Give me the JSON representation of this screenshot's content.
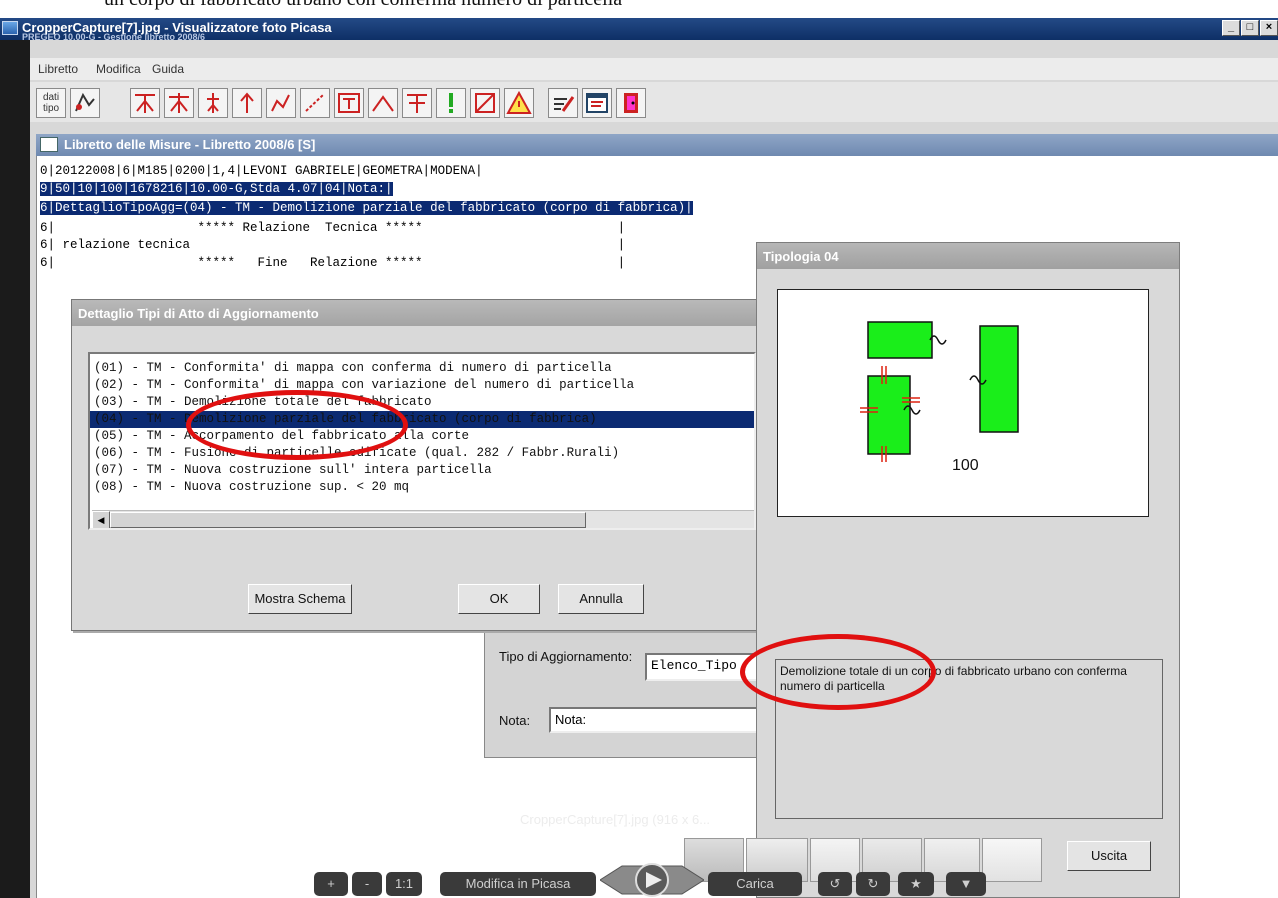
{
  "caption": "un  corpo di  fabbricato urbano con conferma numero di particella",
  "viewer": {
    "title": "CropperCapture[7].jpg - Visualizzatore foto Picasa",
    "subtitle": "PREGEO 10.00-G - Gestione libretto 2008/6"
  },
  "menu": {
    "items": [
      "Libretto",
      "Modifica",
      "Guida"
    ]
  },
  "toolbar": {
    "dati_tipo_label": "dati\ntipo"
  },
  "libretto_window": {
    "title": "Libretto delle Misure - Libretto 2008/6 [S]",
    "lines": [
      "0|20122008|6|M185|0200|1,4|LEVONI GABRIELE|GEOMETRA|MODENA|",
      "9|50|10|100|1678216|10.00-G,Stda 4.07|04|Nota:|",
      "6|DettaglioTipoAgg=(04) - TM - Demolizione parziale del fabbricato (corpo di fabbrica)|",
      "6|                   ***** Relazione  Tecnica *****                          |",
      "6| relazione tecnica                                                         |",
      "6|                   *****   Fine   Relazione *****                          |"
    ]
  },
  "dettaglio_dialog": {
    "title": "Dettaglio Tipi di Atto di Aggiornamento",
    "items": [
      "(01) - TM - Conformita' di mappa con conferma di numero di particella",
      "(02) - TM - Conformita' di mappa con variazione del numero di particella",
      "(03) - TM - Demolizione totale del fabbricato",
      "(04) - TM - Demolizione parziale del fabbricato (corpo di fabbrica)",
      "(05) - TM - Accorpamento del fabbricato alla corte",
      "(06) - TM - Fusione di particelle edificate (qual. 282 / Fabbr.Rurali)",
      "(07) - TM - Nuova costruzione sull' intera particella",
      "(08) - TM - Nuova costruzione sup. < 20 mq"
    ],
    "selected_index": 3,
    "mostra_schema": "Mostra Schema",
    "ok": "OK",
    "annulla": "Annulla"
  },
  "lower_panel": {
    "tipo_label": "Tipo di Aggiornamento:",
    "tipo_value": "Elenco_Tipo",
    "nota_label": "Nota:",
    "nota_value": "Nota:"
  },
  "tipologia": {
    "title": "Tipologia 04",
    "schema_number": "100",
    "description": "Demolizione totale di un  corpo di  fabbricato urbano con conferma numero di particella",
    "uscita": "Uscita"
  },
  "picasa_bar": {
    "plus": "+",
    "minus": "-",
    "one_to_one": "1:1",
    "modifica": "Modifica in Picasa",
    "carica": "Carica",
    "watermark": "CropperCapture[7].jpg (916 x 6..."
  },
  "colors": {
    "selection": "#0b2a72",
    "highlight_circle": "#e01010",
    "building_fill": "#1aee1a"
  }
}
